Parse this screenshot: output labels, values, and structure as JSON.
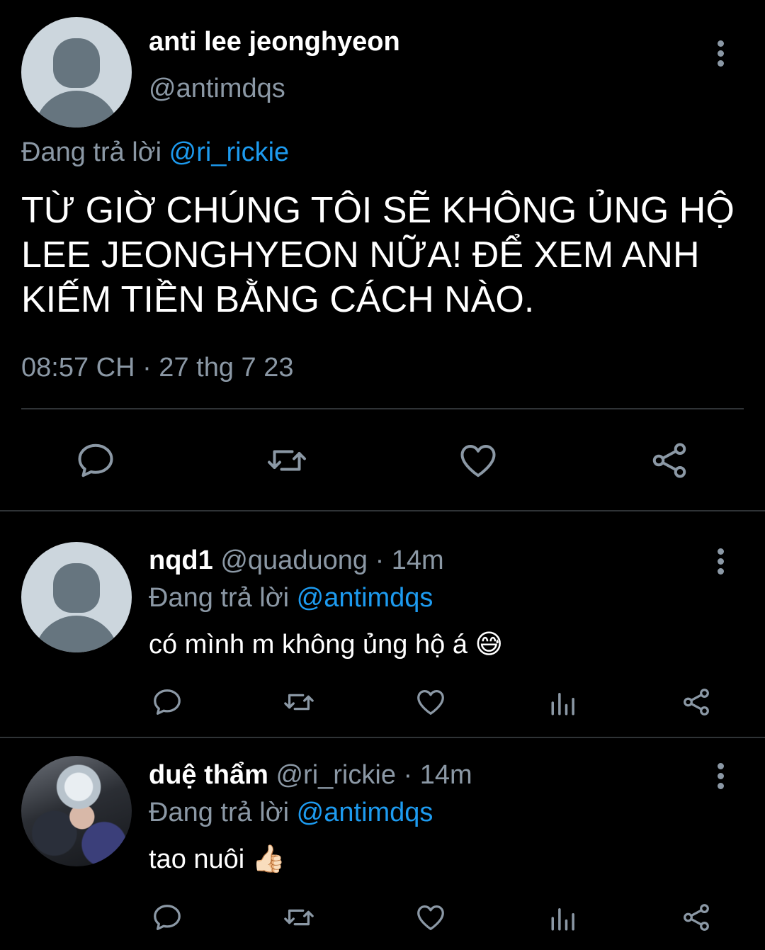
{
  "main_tweet": {
    "display_name": "anti lee jeonghyeon",
    "handle": "@antimdqs",
    "reply_prefix": "Đang trả lời",
    "reply_to": "@ri_rickie",
    "text_line1": "TỪ GIỜ CHÚNG TÔI SẼ KHÔNG ỦNG HỘ",
    "text_line2": "LEE JEONGHYEON NỮA! ĐỂ XEM ANH",
    "text_line3": "KIẾM TIỀN BẰNG CÁCH NÀO.",
    "timestamp": "08:57 CH · 27 thg 7 23"
  },
  "replies": [
    {
      "display_name": "nqd1",
      "handle": "@quaduong",
      "time": "· 14m",
      "reply_prefix": "Đang trả lời",
      "reply_to": "@antimdqs",
      "text": "có mình m không ủng hộ á 😅"
    },
    {
      "display_name": "duệ thẩm",
      "handle": "@ri_rickie",
      "time": "· 14m",
      "reply_prefix": "Đang trả lời",
      "reply_to": "@antimdqs",
      "text": "tao nuôi 👍🏻"
    }
  ],
  "icons": {
    "reply": "reply-icon",
    "retweet": "retweet-icon",
    "like": "like-icon",
    "views": "views-icon",
    "share": "share-icon",
    "more": "more-options-icon"
  },
  "colors": {
    "background": "#000000",
    "text": "#e7e9ea",
    "muted": "#8b98a5",
    "link": "#1d9bf0",
    "divider": "#2f3336"
  }
}
